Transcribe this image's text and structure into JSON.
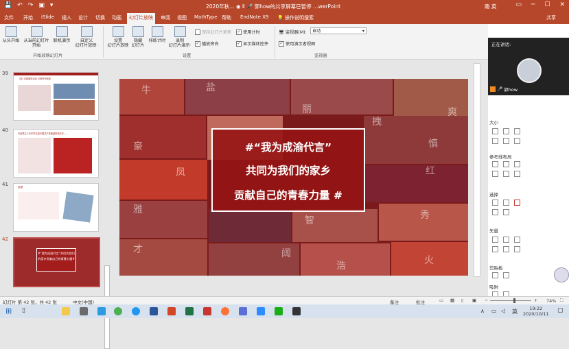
{
  "titlebar": {
    "title": "2020年秋…  ◉ Ⅱ 🎤 郭how的共享屏幕已暂停  …werPoint",
    "user": "路 英",
    "qa_icons": [
      "save-icon",
      "undo-icon",
      "redo-icon",
      "present-icon",
      "dropdown-icon"
    ]
  },
  "tabs": [
    "文件",
    "开始",
    "iSlide",
    "插入",
    "设计",
    "切换",
    "动画",
    "幻灯片放映",
    "审阅",
    "视图",
    "MathType",
    "帮助",
    "EndNote X9",
    "💡 操作说明搜索"
  ],
  "share_label": "共享",
  "ribbon": {
    "from_start": "从头开始",
    "from_current": "从当前幻灯片\n开始",
    "online": "联机演示\n·",
    "custom": "自定义\n幻灯片放映·",
    "group1": "开始放映幻灯片",
    "setup": "设置\n幻灯片放映",
    "hide": "隐藏\n幻灯片",
    "rehearse": "排练计时",
    "record": "录制\n幻灯片演示·",
    "chk_keep_timing": "保持幻灯片更新",
    "chk_use_timing": "使用计时",
    "chk_narration": "播放旁白",
    "chk_media": "显示媒体控件",
    "group2": "设置",
    "monitor_label": "监视器(M):",
    "monitor_value": "自动",
    "chk_presenter": "使用演示者视图",
    "group3": "监视器"
  },
  "thumbnails": [
    {
      "num": "39",
      "title": "(四) 志愿服务活动  引领时代新风"
    },
    {
      "num": "40",
      "title": "马克思主义青年学生是中国共产党团结带领青年……"
    },
    {
      "num": "41",
      "title": "结语"
    },
    {
      "num": "42",
      "title": "#“我为成渝代言”共同为我们的家乡贡献自己的青春力量#"
    }
  ],
  "slide": {
    "line1": "#“我为成渝代言”",
    "line2": "共同为我们的家乡",
    "line3": "贡献自己的青春力量 #",
    "bg_chars": [
      "牛",
      "盐",
      "丽",
      "爽",
      "豪",
      "拽",
      "慎",
      "凤",
      "红",
      "雅",
      "智",
      "秀",
      "才",
      "阔",
      "浩",
      "火"
    ]
  },
  "meeting": {
    "speaking_label": "正在讲话:",
    "speaker_name": "郭how"
  },
  "right_panel": {
    "size_label": "大小",
    "layout_label": "参考线布局",
    "select_label": "选择",
    "vector_label": "矢量",
    "clipboard_label": "剪贴板",
    "absorb_label": "吸附"
  },
  "status": {
    "slide_info": "幻灯片 第 42 张，共 42 张",
    "language": "中文(中国)",
    "notes": "备注",
    "comments": "批注",
    "zoom": "74%"
  },
  "taskbar": {
    "time": "19:22",
    "date": "2020/10/11",
    "lang": "英"
  },
  "colors": {
    "accent": "#b7472a",
    "slide_red": "#a31d1d"
  }
}
